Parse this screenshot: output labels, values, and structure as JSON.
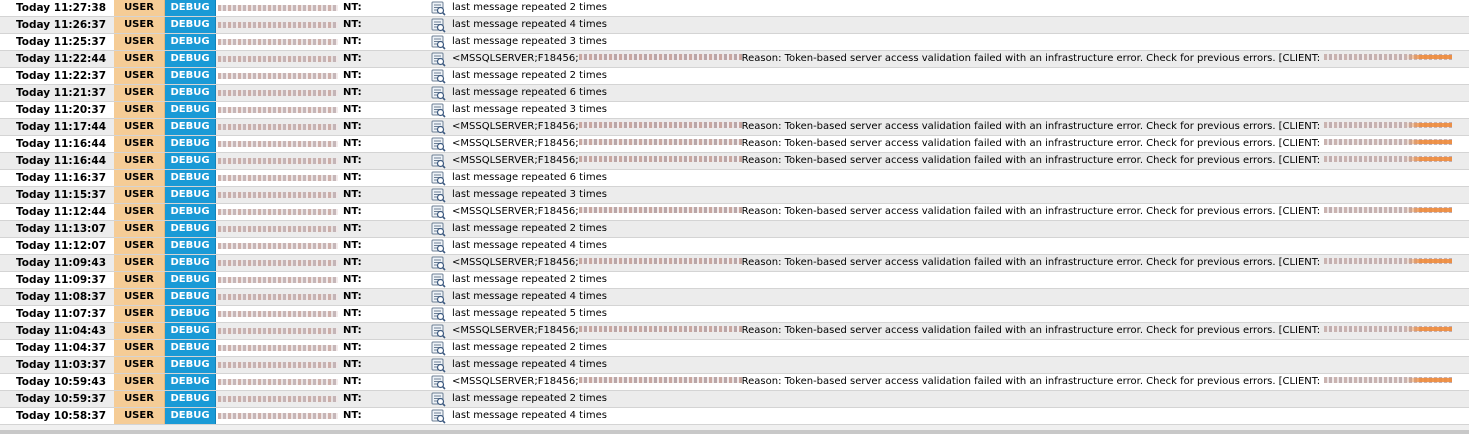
{
  "log": {
    "tag": "NT:",
    "icon": "message-detail-icon",
    "client_prefix": "[CLIENT:",
    "client_suffix": "]",
    "rows": [
      {
        "time": "Today 11:27:38",
        "facility": "USER",
        "level": "DEBUG",
        "type": "repeat",
        "text": "last message repeated 2 times"
      },
      {
        "time": "Today 11:26:37",
        "facility": "USER",
        "level": "DEBUG",
        "type": "repeat",
        "text": "last message repeated 4 times"
      },
      {
        "time": "Today 11:25:37",
        "facility": "USER",
        "level": "DEBUG",
        "type": "repeat",
        "text": "last message repeated 3 times"
      },
      {
        "time": "Today 11:22:44",
        "facility": "USER",
        "level": "DEBUG",
        "type": "error",
        "prefix": "<MSSQLSERVER;F18456;",
        "reason": "Reason: Token-based server access validation failed with an infrastructure error. Check for previous errors."
      },
      {
        "time": "Today 11:22:37",
        "facility": "USER",
        "level": "DEBUG",
        "type": "repeat",
        "text": "last message repeated 2 times"
      },
      {
        "time": "Today 11:21:37",
        "facility": "USER",
        "level": "DEBUG",
        "type": "repeat",
        "text": "last message repeated 6 times"
      },
      {
        "time": "Today 11:20:37",
        "facility": "USER",
        "level": "DEBUG",
        "type": "repeat",
        "text": "last message repeated 3 times"
      },
      {
        "time": "Today 11:17:44",
        "facility": "USER",
        "level": "DEBUG",
        "type": "error",
        "prefix": "<MSSQLSERVER;F18456;",
        "reason": "Reason: Token-based server access validation failed with an infrastructure error. Check for previous errors."
      },
      {
        "time": "Today 11:16:44",
        "facility": "USER",
        "level": "DEBUG",
        "type": "error",
        "prefix": "<MSSQLSERVER;F18456;",
        "reason": "Reason: Token-based server access validation failed with an infrastructure error. Check for previous errors."
      },
      {
        "time": "Today 11:16:44",
        "facility": "USER",
        "level": "DEBUG",
        "type": "error",
        "prefix": "<MSSQLSERVER;F18456;",
        "reason": "Reason: Token-based server access validation failed with an infrastructure error. Check for previous errors."
      },
      {
        "time": "Today 11:16:37",
        "facility": "USER",
        "level": "DEBUG",
        "type": "repeat",
        "text": "last message repeated 6 times"
      },
      {
        "time": "Today 11:15:37",
        "facility": "USER",
        "level": "DEBUG",
        "type": "repeat",
        "text": "last message repeated 3 times"
      },
      {
        "time": "Today 11:12:44",
        "facility": "USER",
        "level": "DEBUG",
        "type": "error",
        "prefix": "<MSSQLSERVER;F18456;",
        "reason": "Reason: Token-based server access validation failed with an infrastructure error. Check for previous errors."
      },
      {
        "time": "Today 11:13:07",
        "facility": "USER",
        "level": "DEBUG",
        "type": "repeat",
        "text": "last message repeated 2 times"
      },
      {
        "time": "Today 11:12:07",
        "facility": "USER",
        "level": "DEBUG",
        "type": "repeat",
        "text": "last message repeated 4 times"
      },
      {
        "time": "Today 11:09:43",
        "facility": "USER",
        "level": "DEBUG",
        "type": "error",
        "prefix": "<MSSQLSERVER;F18456;",
        "reason": "Reason: Token-based server access validation failed with an infrastructure error. Check for previous errors."
      },
      {
        "time": "Today 11:09:37",
        "facility": "USER",
        "level": "DEBUG",
        "type": "repeat",
        "text": "last message repeated 2 times"
      },
      {
        "time": "Today 11:08:37",
        "facility": "USER",
        "level": "DEBUG",
        "type": "repeat",
        "text": "last message repeated 4 times"
      },
      {
        "time": "Today 11:07:37",
        "facility": "USER",
        "level": "DEBUG",
        "type": "repeat",
        "text": "last message repeated 5 times"
      },
      {
        "time": "Today 11:04:43",
        "facility": "USER",
        "level": "DEBUG",
        "type": "error",
        "prefix": "<MSSQLSERVER;F18456;",
        "reason": "Reason: Token-based server access validation failed with an infrastructure error. Check for previous errors."
      },
      {
        "time": "Today 11:04:37",
        "facility": "USER",
        "level": "DEBUG",
        "type": "repeat",
        "text": "last message repeated 2 times"
      },
      {
        "time": "Today 11:03:37",
        "facility": "USER",
        "level": "DEBUG",
        "type": "repeat",
        "text": "last message repeated 4 times"
      },
      {
        "time": "Today 10:59:43",
        "facility": "USER",
        "level": "DEBUG",
        "type": "error",
        "prefix": "<MSSQLSERVER;F18456;",
        "reason": "Reason: Token-based server access validation failed with an infrastructure error. Check for previous errors."
      },
      {
        "time": "Today 10:59:37",
        "facility": "USER",
        "level": "DEBUG",
        "type": "repeat",
        "text": "last message repeated 2 times"
      },
      {
        "time": "Today 10:58:37",
        "facility": "USER",
        "level": "DEBUG",
        "type": "repeat",
        "text": "last message repeated 4 times"
      }
    ]
  }
}
